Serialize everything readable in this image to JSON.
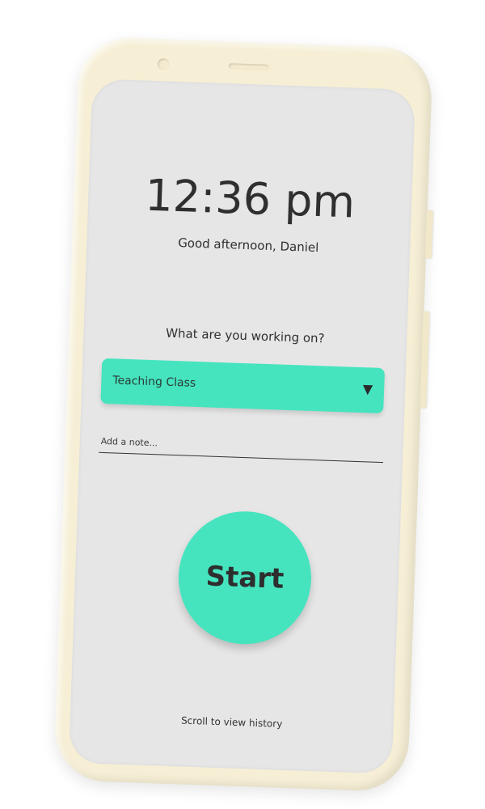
{
  "clock": {
    "time": "12:36 pm",
    "greeting": "Good afternoon, Daniel"
  },
  "activity": {
    "question": "What are you working on?",
    "selected": "Teaching Class",
    "dropdown_icon": "caret-down-icon",
    "dropdown_glyph": "▼"
  },
  "note": {
    "placeholder": "Add a note...",
    "value": ""
  },
  "actions": {
    "start_label": "Start"
  },
  "footer": {
    "scroll_hint": "Scroll to view history"
  },
  "colors": {
    "accent": "#45e4bf",
    "screen_bg": "#e6e6e6",
    "device_shell": "#f6efd5",
    "text": "#2f2f2f"
  }
}
